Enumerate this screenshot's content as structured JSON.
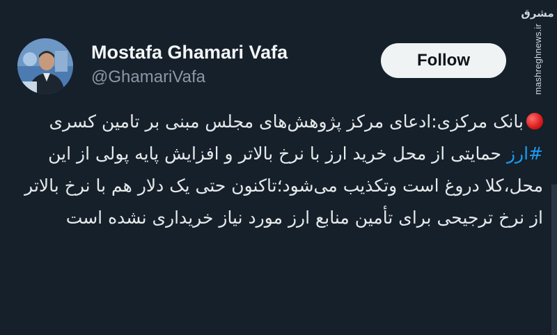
{
  "watermark": {
    "logo": "مشرق",
    "url": "mashreghnews.ir"
  },
  "user": {
    "name": "Mostafa Ghamari Vafa",
    "handle": "@GhamariVafa"
  },
  "follow_button": {
    "label": "Follow"
  },
  "tweet": {
    "segment_1": "بانک مرکزی:ادعای مرکز پژوهش‌های مجلس مبنی بر تامین کسری ",
    "hashtag": "#ارز",
    "segment_2": " حمایتی از محل خرید ارز با نرخ بالاتر و افزایش پایه پولی از این محل،کلا دروغ است وتکذیب می‌شود؛تاکنون حتی یک دلار هم با نرخ بالاتر از نرخ ترجیحی برای تأمین منابع ارز مورد نیاز خریداری نشده است"
  },
  "colors": {
    "background": "#15202b",
    "hashtag": "#1d9bf0",
    "button": "#eff3f4"
  },
  "icons": [
    "red-circle-emoji",
    "avatar-photo"
  ]
}
